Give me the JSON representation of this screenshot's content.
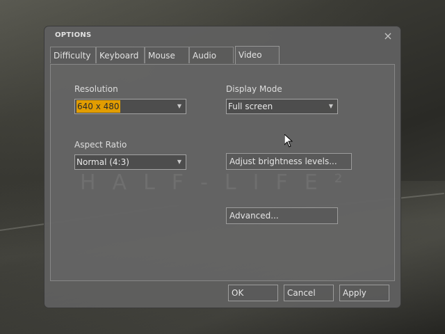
{
  "dialog": {
    "title": "OPTIONS",
    "close_glyph": "×"
  },
  "tabs": [
    {
      "label": "Difficulty",
      "active": false
    },
    {
      "label": "Keyboard",
      "active": false
    },
    {
      "label": "Mouse",
      "active": false
    },
    {
      "label": "Audio",
      "active": false
    },
    {
      "label": "Video",
      "active": true
    }
  ],
  "video": {
    "resolution_label": "Resolution",
    "resolution_value": "640 x 480",
    "display_mode_label": "Display Mode",
    "display_mode_value": "Full screen",
    "aspect_ratio_label": "Aspect Ratio",
    "aspect_ratio_value": "Normal (4:3)",
    "brightness_button": "Adjust brightness levels...",
    "advanced_button": "Advanced..."
  },
  "footer": {
    "ok": "OK",
    "cancel": "Cancel",
    "apply": "Apply"
  },
  "background": {
    "watermark": "HALF-LIFE²"
  },
  "colors": {
    "highlight": "#e8a000",
    "dialog_bg": "#5f5f5f"
  },
  "icons": {
    "dropdown": "chevron-down-icon",
    "close": "close-icon",
    "cursor": "mouse-pointer-icon"
  }
}
